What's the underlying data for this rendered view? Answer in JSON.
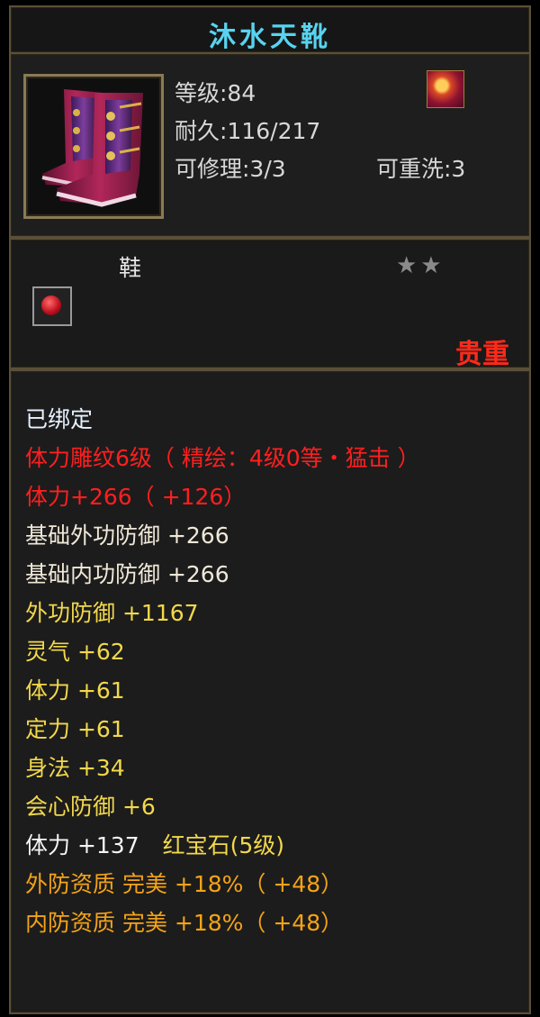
{
  "title": "沐水天靴",
  "info": {
    "level": "等级:84",
    "durability": "耐久:116/217",
    "repair": "可修理:3/3",
    "reforge": "可重洗:3"
  },
  "type": {
    "label": "鞋",
    "stars": "★★",
    "rarity": "贵重"
  },
  "attributes": [
    {
      "text": "已绑定",
      "color": "#e8f2ff"
    },
    {
      "text": "体力雕纹6级（ 精绘：4级0等・猛击 ）",
      "color": "#ff1f1f"
    },
    {
      "text": "体力+266（ +126）",
      "color": "#ff1f1f"
    },
    {
      "text": "基础外功防御 +266",
      "color": "#f0e8d8"
    },
    {
      "text": "基础内功防御 +266",
      "color": "#f0e8d8"
    },
    {
      "text": "外功防御 +1167",
      "color": "#f2d84b"
    },
    {
      "text": "灵气 +62",
      "color": "#f2d84b"
    },
    {
      "text": "体力 +61",
      "color": "#f2d84b"
    },
    {
      "text": "定力 +61",
      "color": "#f2d84b"
    },
    {
      "text": "身法 +34",
      "color": "#f2d84b"
    },
    {
      "text": "会心防御 +6",
      "color": "#f2d84b"
    },
    {
      "text": "体力 +137",
      "color": "#f5f5f5",
      "extra": "红宝石(5级)",
      "extra_color": "#f2d84b"
    },
    {
      "text": "外防资质  完美 +18%（ +48）",
      "color": "#f4a318"
    },
    {
      "text": "内防资质  完美 +18%（ +48）",
      "color": "#f4a318"
    }
  ]
}
